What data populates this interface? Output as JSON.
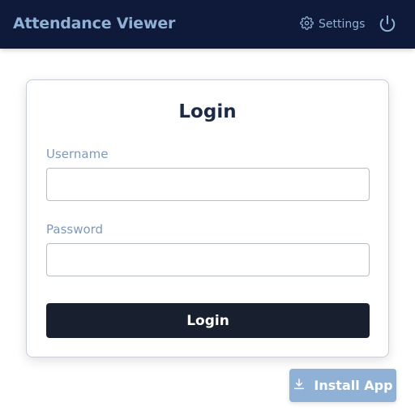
{
  "header": {
    "title": "Attendance Viewer",
    "settings_label": "Settings",
    "settings_icon": "gear-icon",
    "power_icon": "power-icon"
  },
  "login": {
    "title": "Login",
    "username_label": "Username",
    "username_value": "",
    "password_label": "Password",
    "password_value": "",
    "submit_label": "Login"
  },
  "install": {
    "label": "Install App",
    "icon": "download-icon"
  },
  "colors": {
    "header_bg": "#0f1a3a",
    "accent": "#8fb1d6",
    "button_dark": "#18202f",
    "title_text": "#1c2a45"
  }
}
